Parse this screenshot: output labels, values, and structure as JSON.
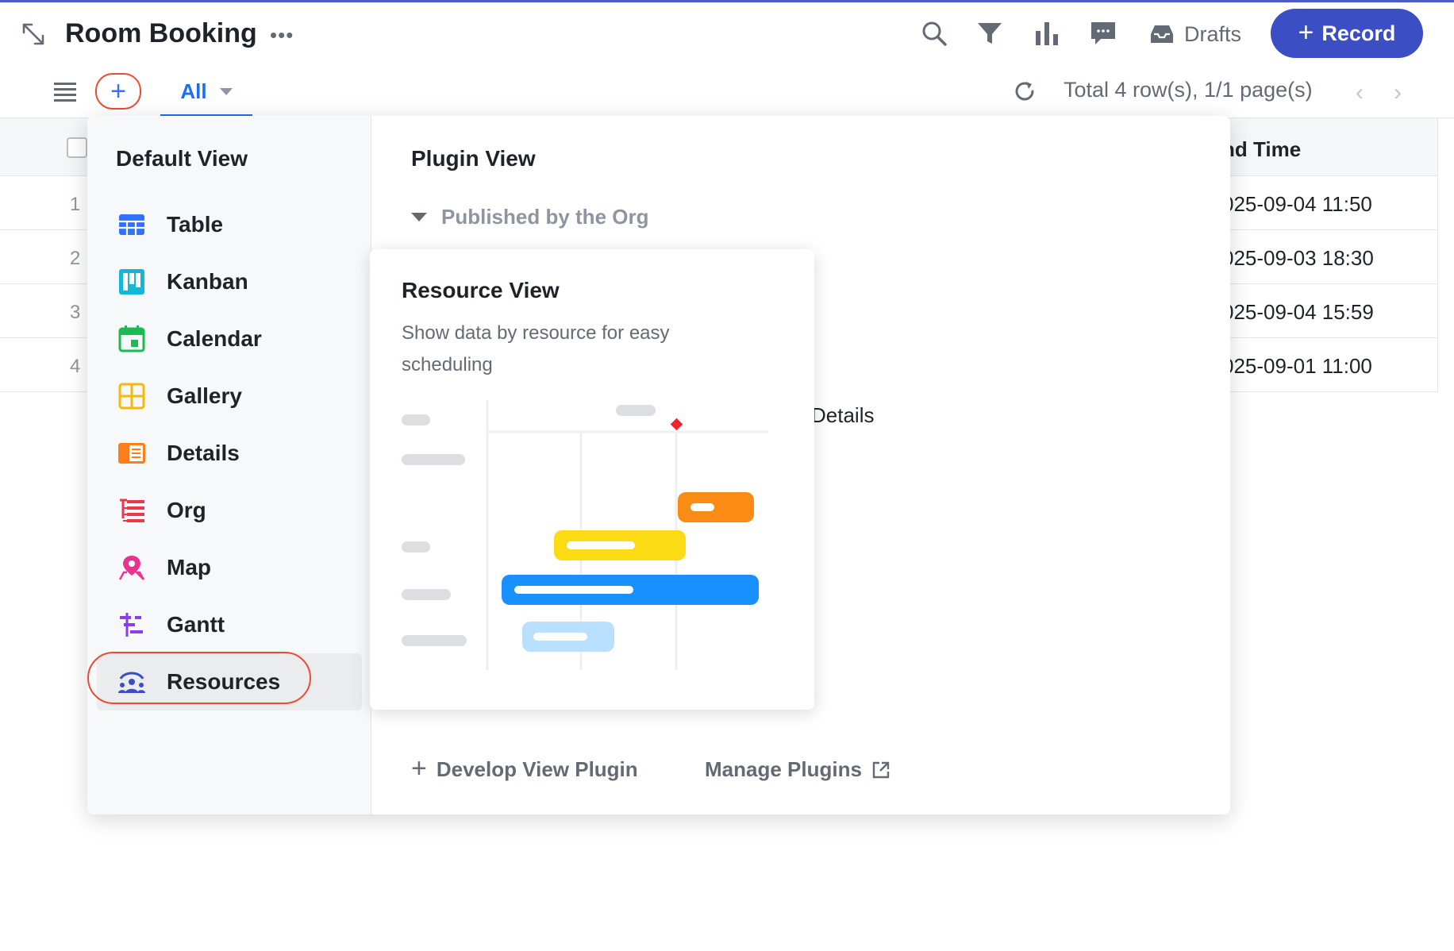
{
  "app": {
    "title": "Room Booking",
    "accent_color": "#3b4ec4",
    "link_color": "#1a6ef5",
    "highlight_ring_color": "#e94b34"
  },
  "header": {
    "icons": [
      "expand-icon",
      "more-icon",
      "search-icon",
      "filter-icon",
      "chart-icon",
      "comment-icon",
      "inbox-icon"
    ],
    "drafts_label": "Drafts",
    "record_button_label": "Record",
    "record_button_prefix": "+"
  },
  "toolbar": {
    "add_view_symbol": "+",
    "active_tab": "All",
    "pagination_text": "Total 4 row(s), 1/1 page(s)",
    "prev_symbol": "‹",
    "next_symbol": "›"
  },
  "table": {
    "visible_header": "nd Time",
    "rows": [
      {
        "num": "1",
        "time": "025-09-04 11:50"
      },
      {
        "num": "2",
        "time": "025-09-03 18:30"
      },
      {
        "num": "3",
        "time": "025-09-04 15:59"
      },
      {
        "num": "4",
        "time": "025-09-01 11:00"
      }
    ]
  },
  "menu": {
    "default_view_title": "Default View",
    "default_views": [
      {
        "label": "Table",
        "icon": "table-icon",
        "color": "#3370ff"
      },
      {
        "label": "Kanban",
        "icon": "kanban-icon",
        "color": "#14b8d6"
      },
      {
        "label": "Calendar",
        "icon": "calendar-icon",
        "color": "#1db954"
      },
      {
        "label": "Gallery",
        "icon": "gallery-icon",
        "color": "#f5b90a"
      },
      {
        "label": "Details",
        "icon": "details-icon",
        "color": "#ff7d1a"
      },
      {
        "label": "Org",
        "icon": "org-icon",
        "color": "#f0344c"
      },
      {
        "label": "Map",
        "icon": "map-pin-icon",
        "color": "#e8338f"
      },
      {
        "label": "Gantt",
        "icon": "gantt-icon",
        "color": "#8a3cf0"
      },
      {
        "label": "Resources",
        "icon": "resources-icon",
        "color": "#3b4ec4"
      }
    ],
    "active_view": "Resources",
    "plugin_view_title": "Plugin View",
    "plugin_group_label": "Published by the Org",
    "plugin_item_partial": "Details",
    "develop_plugin_label": "Develop View Plugin",
    "manage_plugins_label": "Manage Plugins"
  },
  "tooltip_card": {
    "title": "Resource View",
    "description": "Show data by resource for easy scheduling",
    "illustration": "resource-timeline-illustration",
    "bar_colors": [
      "#fa8c16",
      "#fadb14",
      "#1890ff",
      "#bae0ff"
    ]
  }
}
